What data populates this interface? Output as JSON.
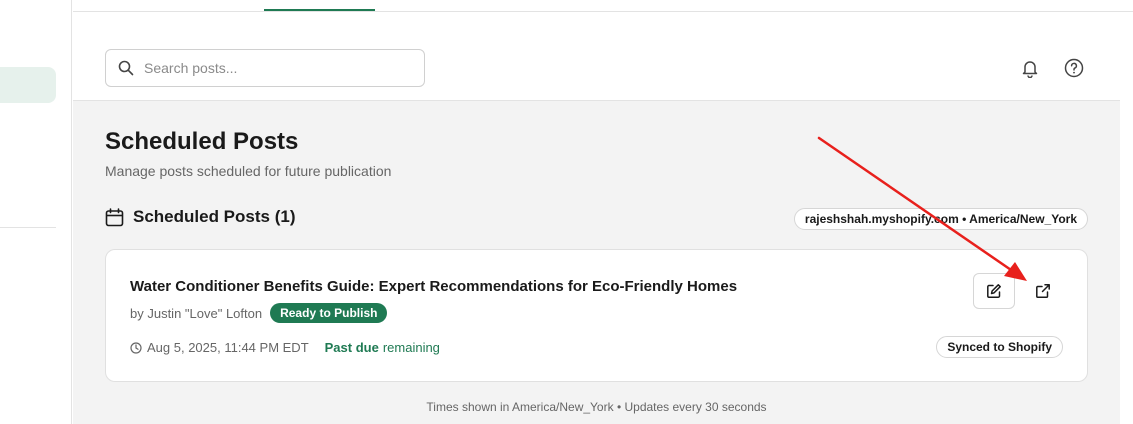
{
  "search": {
    "placeholder": "Search posts..."
  },
  "header": {
    "notifications_icon": "bell-icon",
    "help_icon": "question-circle-icon"
  },
  "page": {
    "title": "Scheduled Posts",
    "subtitle": "Manage posts scheduled for future publication"
  },
  "section": {
    "title": "Scheduled Posts (1)",
    "icon": "calendar-icon",
    "store_badge": "rajeshshah.myshopify.com • America/New_York"
  },
  "posts": [
    {
      "title": "Water Conditioner Benefits Guide: Expert Recommendations for Eco-Friendly Homes",
      "author": "by Justin \"Love\" Lofton",
      "status": "Ready to Publish",
      "scheduled": "Aug 5, 2025, 11:44 PM EDT",
      "past_due": "Past due",
      "remaining": "remaining",
      "sync_status": "Synced to Shopify"
    }
  ],
  "footer": {
    "note": "Times shown in America/New_York • Updates every 30 seconds"
  },
  "colors": {
    "accent": "#1f7a53",
    "annotation_arrow": "#e8201c",
    "background": "#f3f3f3"
  }
}
